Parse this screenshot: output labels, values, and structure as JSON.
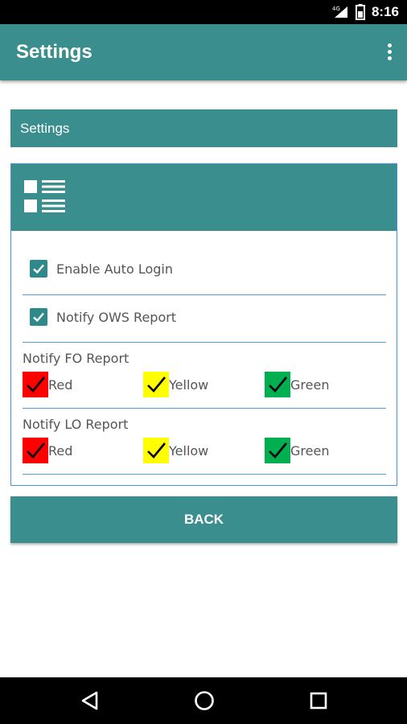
{
  "status_bar": {
    "time": "8:16",
    "network": "4G"
  },
  "app_bar": {
    "title": "Settings",
    "menu_icon": "overflow-menu-icon"
  },
  "section": {
    "title": "Settings"
  },
  "card": {
    "header_icon": "list-view-icon"
  },
  "options": [
    {
      "label": "Enable Auto Login",
      "checked": true
    },
    {
      "label": "Notify OWS Report",
      "checked": true
    }
  ],
  "groups": [
    {
      "label": "Notify FO Report",
      "colors": [
        {
          "label": "Red",
          "color": "#ff0000",
          "checked": true
        },
        {
          "label": "Yellow",
          "color": "#ffff00",
          "checked": true
        },
        {
          "label": "Green",
          "color": "#00b050",
          "checked": true
        }
      ]
    },
    {
      "label": "Notify LO Report",
      "colors": [
        {
          "label": "Red",
          "color": "#ff0000",
          "checked": true
        },
        {
          "label": "Yellow",
          "color": "#ffff00",
          "checked": true
        },
        {
          "label": "Green",
          "color": "#00b050",
          "checked": true
        }
      ]
    }
  ],
  "back_button": {
    "label": "BACK"
  },
  "nav_bar": {
    "back_icon": "back-triangle-icon",
    "home_icon": "home-circle-icon",
    "recents_icon": "recents-square-icon"
  },
  "colors": {
    "primary": "#3a8f8e",
    "checkbox": "#2e8a8a",
    "divider": "#5b9bd5"
  }
}
